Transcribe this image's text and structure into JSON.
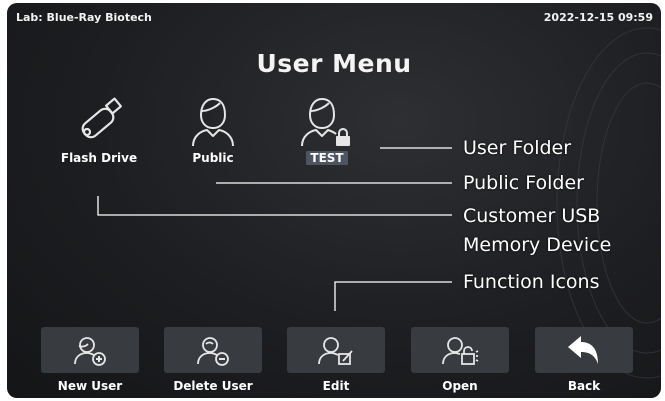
{
  "status_bar": {
    "lab": "Lab: Blue-Ray Biotech",
    "datetime": "2022-12-15 09:59"
  },
  "title": "User Menu",
  "folders": [
    {
      "label": "Flash Drive",
      "icon": "usb-drive-icon",
      "highlighted": false
    },
    {
      "label": "Public",
      "icon": "user-icon",
      "highlighted": false
    },
    {
      "label": "TEST",
      "icon": "locked-user-icon",
      "highlighted": true
    }
  ],
  "callouts": {
    "user_folder": "User Folder",
    "public_folder": "Public Folder",
    "customer_usb_line1": "Customer USB",
    "customer_usb_line2": "Memory Device",
    "function_icons": "Function Icons"
  },
  "function_buttons": [
    {
      "label": "New User",
      "icon": "add-user-icon"
    },
    {
      "label": "Delete User",
      "icon": "remove-user-icon"
    },
    {
      "label": "Edit",
      "icon": "edit-user-icon"
    },
    {
      "label": "Open",
      "icon": "unlock-user-icon"
    },
    {
      "label": "Back",
      "icon": "back-arrow-icon"
    }
  ],
  "colors": {
    "background": "#1d1e21",
    "button": "#383b40",
    "highlight": "#4c5560",
    "text": "#ffffff"
  }
}
